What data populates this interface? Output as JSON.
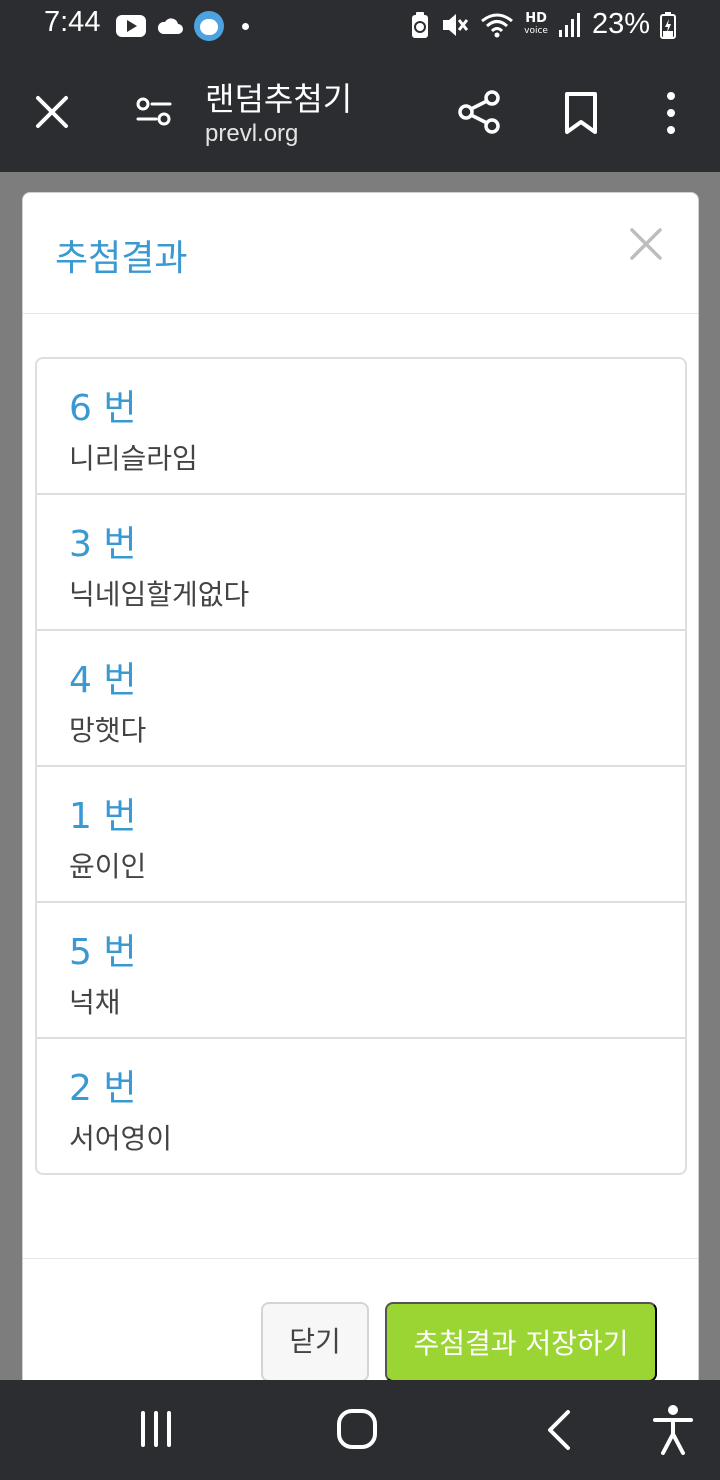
{
  "status_bar": {
    "time": "7:44",
    "battery_percent": "23%",
    "hd_label": "HD",
    "hd_sub": "voice"
  },
  "toolbar": {
    "title": "랜덤추첨기",
    "url": "prevl.org"
  },
  "modal": {
    "title": "추첨결과",
    "results": [
      {
        "number": "6 번",
        "name": "니리슬라임"
      },
      {
        "number": "3 번",
        "name": "닉네임할게없다"
      },
      {
        "number": "4 번",
        "name": "망햇다"
      },
      {
        "number": "1 번",
        "name": "윤이인"
      },
      {
        "number": "5 번",
        "name": "넉채"
      },
      {
        "number": "2 번",
        "name": "서어영이"
      }
    ],
    "close_label": "닫기",
    "save_label": "추첨결과 저장하기"
  },
  "colors": {
    "accent_blue": "#3a99d1",
    "save_green": "#9bd534",
    "chrome_dark": "#2b2d31"
  }
}
